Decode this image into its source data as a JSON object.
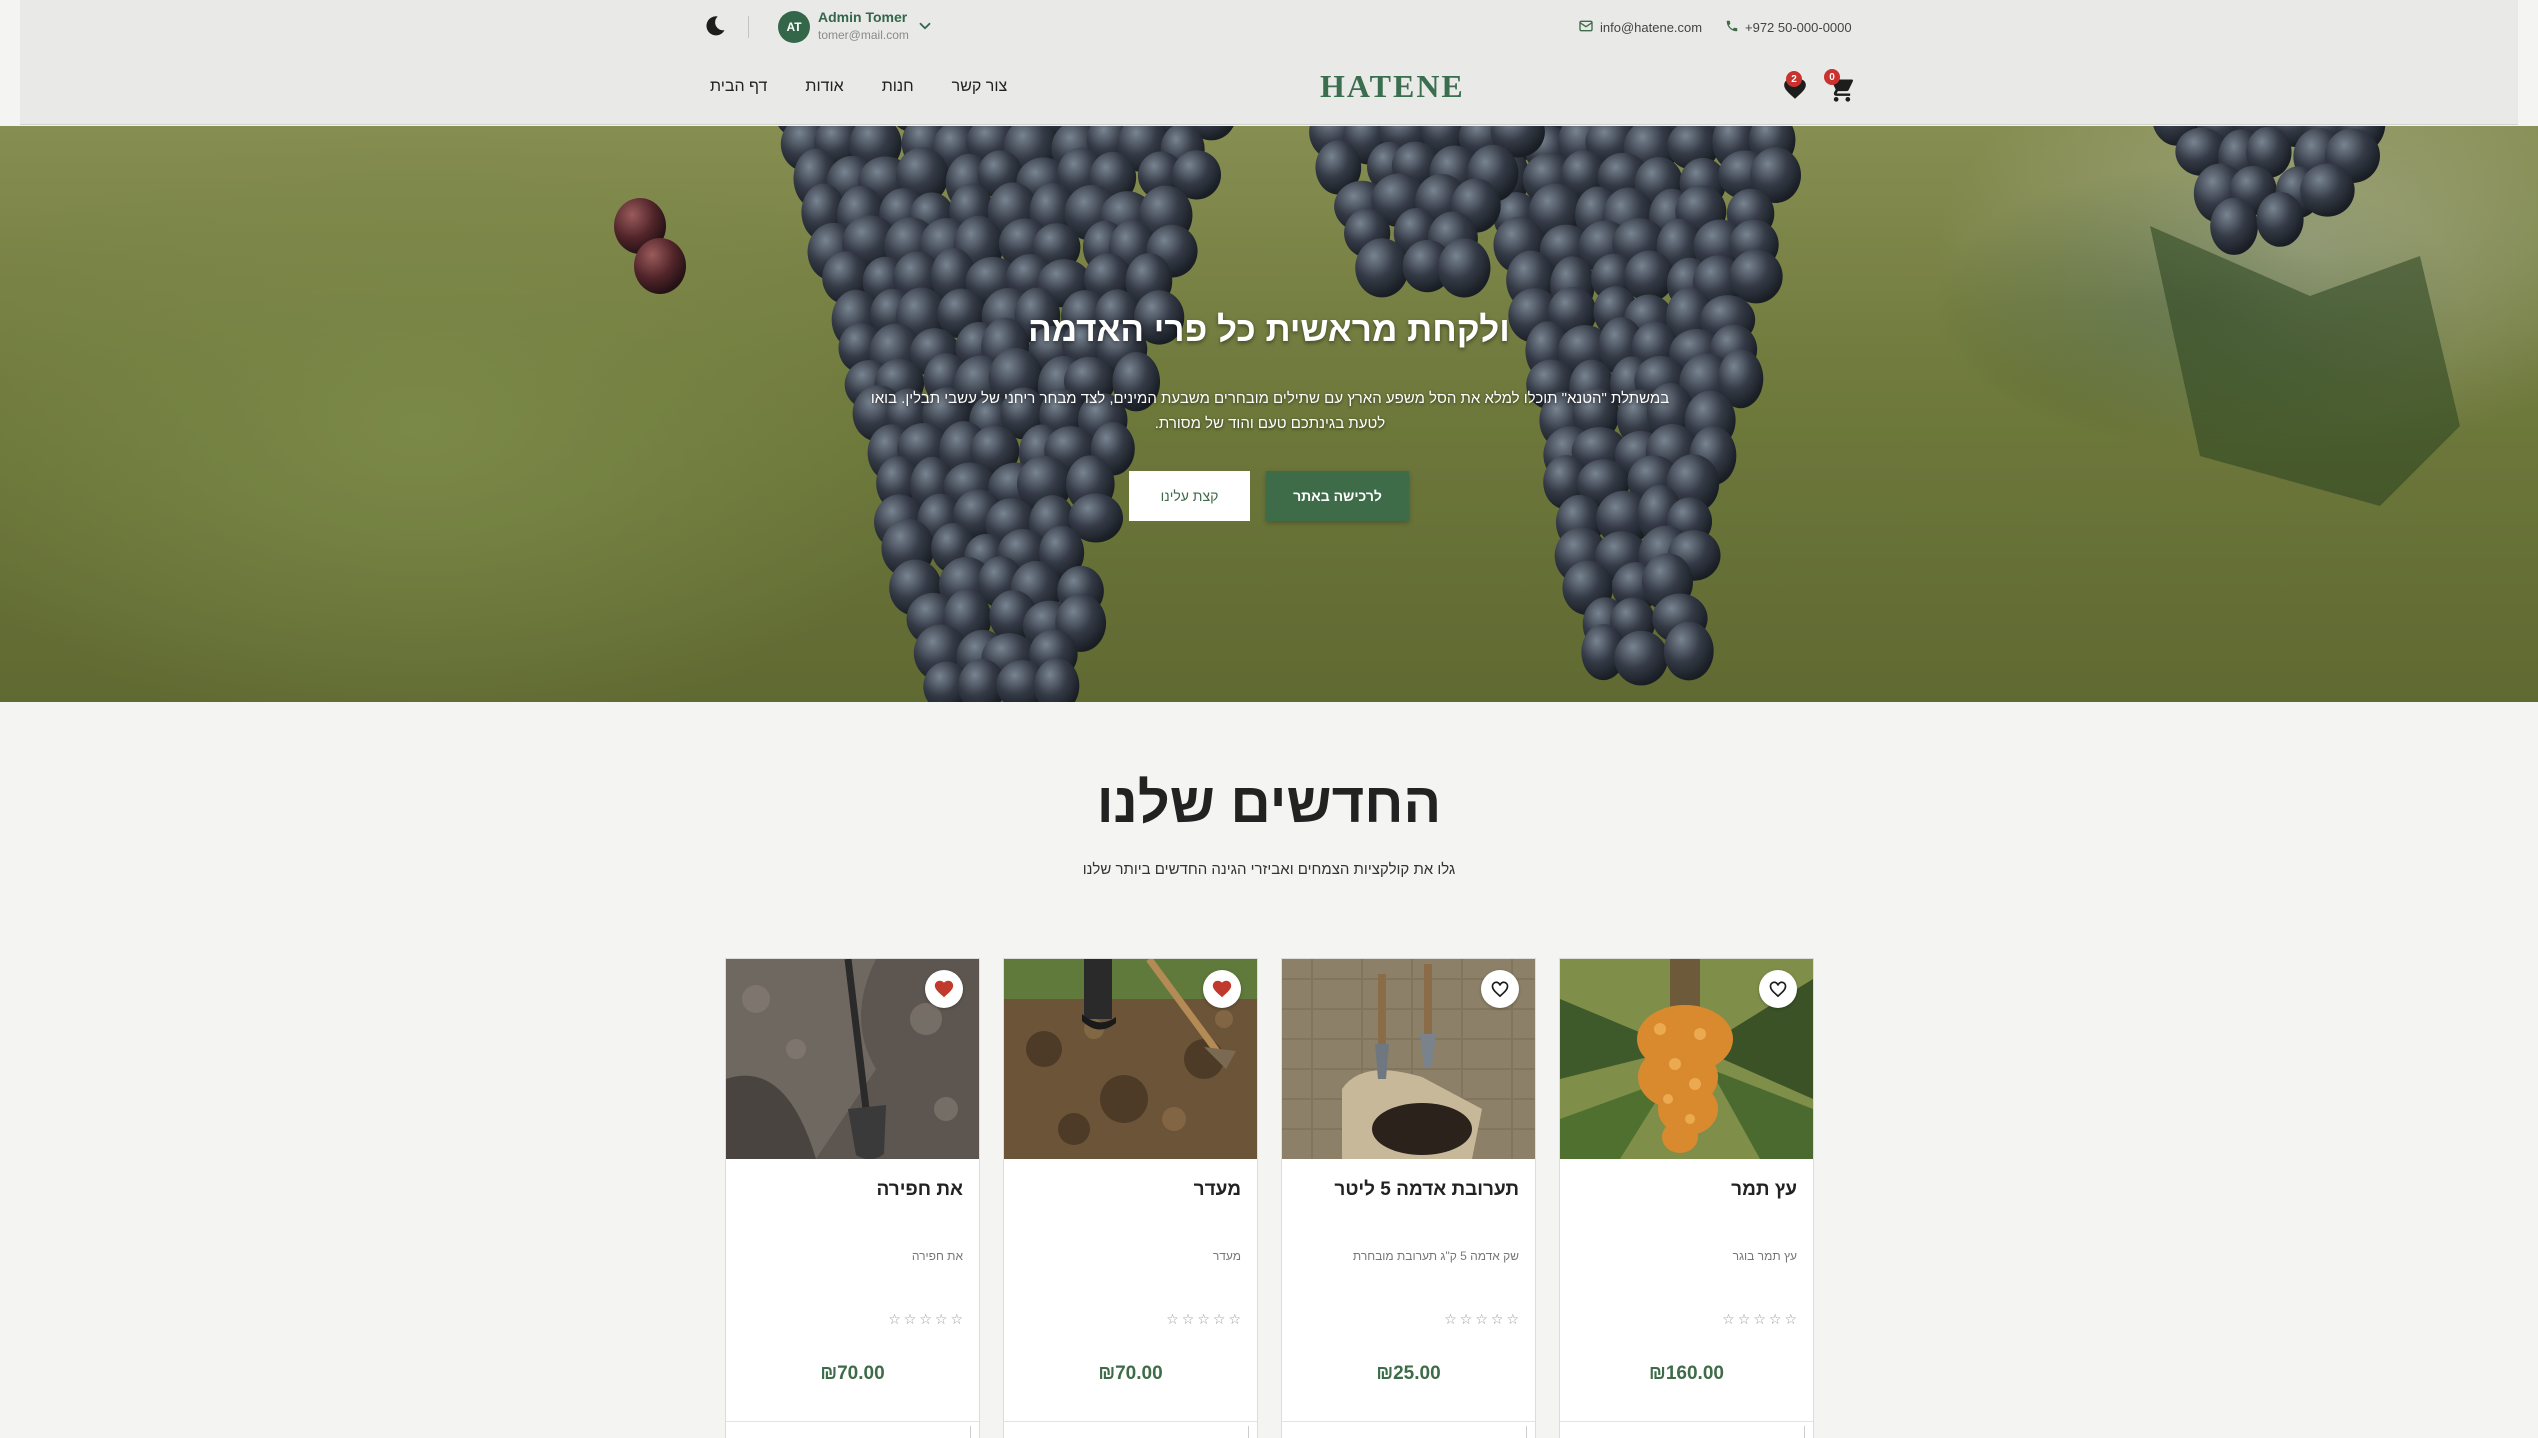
{
  "header": {
    "user": {
      "initials": "AT",
      "name": "Admin Tomer",
      "email": "tomer@mail.com"
    },
    "contact": {
      "email": "info@hatene.com",
      "phone": "+972 50-000-0000"
    },
    "logo": "HATENE",
    "nav": [
      "דף הבית",
      "אודות",
      "חנות",
      "צור קשר"
    ],
    "wishlist_count": "2",
    "cart_count": "0"
  },
  "hero": {
    "title": "ולקחת מראשית כל פרי האדמה",
    "text": "במשתלת \"הטנא\" תוכלו למלא את הסל משפע הארץ עם שתילים מובחרים משבעת המינים, לצד מבחר ריחני של עשבי תבלין. בואו לטעת בגינתכם טעם והוד של מסורת.",
    "primary_button": "לרכישה באתר",
    "secondary_button": "קצת עלינו"
  },
  "new_arrivals": {
    "title": "החדשים שלנו",
    "subtitle": "גלו את קולקציות הצמחים ואביזרי הגינה החדשים ביותר שלנו",
    "products": [
      {
        "name": "עץ תמר",
        "description": "עץ תמר בוגר",
        "price": "₪160.00",
        "rating": 0,
        "favorite": false
      },
      {
        "name": "תערובת אדמה 5 ליטר",
        "description": "שק אדמה 5 ק\"ג תערובת מובחרת",
        "price": "₪25.00",
        "rating": 0,
        "favorite": false
      },
      {
        "name": "מעדר",
        "description": "מעדר",
        "price": "₪70.00",
        "rating": 0,
        "favorite": true
      },
      {
        "name": "את חפירה",
        "description": "את חפירה",
        "price": "₪70.00",
        "rating": 0,
        "favorite": true
      }
    ]
  },
  "colors": {
    "brand_green": "#3e6b48",
    "badge_red": "#c9322e",
    "favorite_red": "#c0392b"
  }
}
